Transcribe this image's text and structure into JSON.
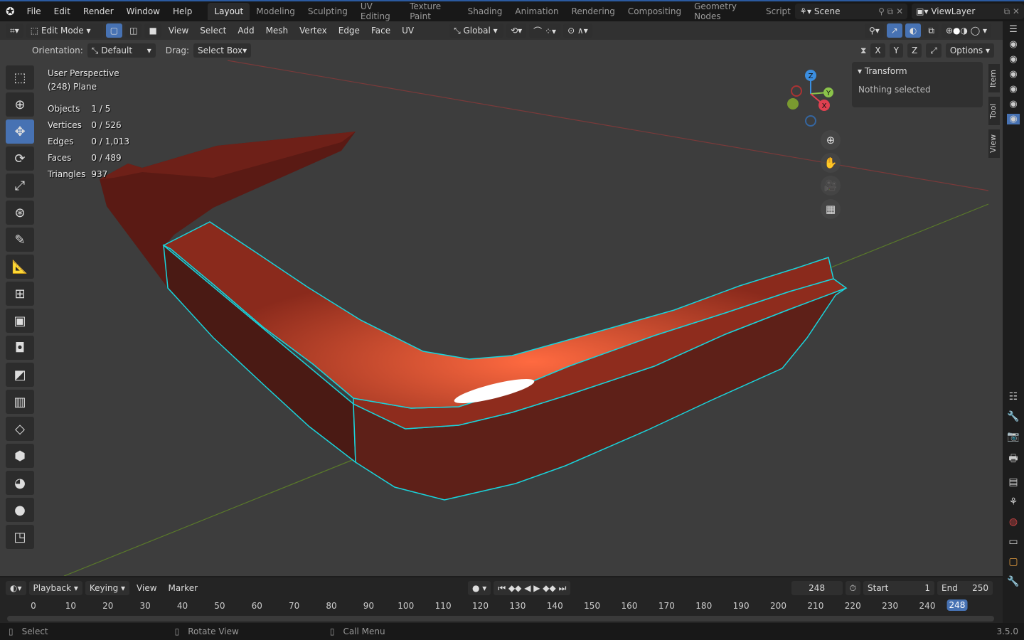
{
  "topbar": {
    "menus": [
      "File",
      "Edit",
      "Render",
      "Window",
      "Help"
    ],
    "workspaces": [
      "Layout",
      "Modeling",
      "Sculpting",
      "UV Editing",
      "Texture Paint",
      "Shading",
      "Animation",
      "Rendering",
      "Compositing",
      "Geometry Nodes",
      "Scripting"
    ],
    "active_workspace": "Layout",
    "scene": "Scene",
    "view_layer": "ViewLayer"
  },
  "header": {
    "mode": "Edit Mode",
    "menus": [
      "View",
      "Select",
      "Add",
      "Mesh",
      "Vertex",
      "Edge",
      "Face",
      "UV"
    ],
    "orientation": "Global"
  },
  "toolsettings": {
    "orientation_label": "Orientation:",
    "orientation_value": "Default",
    "drag_label": "Drag:",
    "drag_value": "Select Box",
    "axes": [
      "X",
      "Y",
      "Z"
    ],
    "options": "Options"
  },
  "overlay": {
    "view_name": "User Perspective",
    "object": "(248) Plane",
    "stats": [
      {
        "label": "Objects",
        "value": "1 / 5"
      },
      {
        "label": "Vertices",
        "value": "0 / 526"
      },
      {
        "label": "Edges",
        "value": "0 / 1,013"
      },
      {
        "label": "Faces",
        "value": "0 / 489"
      },
      {
        "label": "Triangles",
        "value": "937"
      }
    ]
  },
  "npanel": {
    "section": "Transform",
    "message": "Nothing selected",
    "tabs": [
      "Item",
      "Tool",
      "View"
    ]
  },
  "gizmo": {
    "axes": [
      "Z",
      "Y",
      "X"
    ]
  },
  "timeline": {
    "menus": [
      "Playback",
      "Keying",
      "View",
      "Marker"
    ],
    "current_frame": "248",
    "start_label": "Start",
    "start": "1",
    "end_label": "End",
    "end": "250",
    "ticks": [
      "0",
      "10",
      "20",
      "30",
      "40",
      "50",
      "60",
      "70",
      "80",
      "90",
      "100",
      "110",
      "120",
      "130",
      "140",
      "150",
      "160",
      "170",
      "180",
      "190",
      "200",
      "210",
      "220",
      "230",
      "240"
    ],
    "playhead": "248"
  },
  "status": {
    "select": "Select",
    "rotate": "Rotate View",
    "menu": "Call Menu",
    "version": "3.5.0"
  },
  "colors": {
    "accent": "#4772b3",
    "mesh": "#8a2a1c",
    "edge_select": "#19d4dc"
  }
}
